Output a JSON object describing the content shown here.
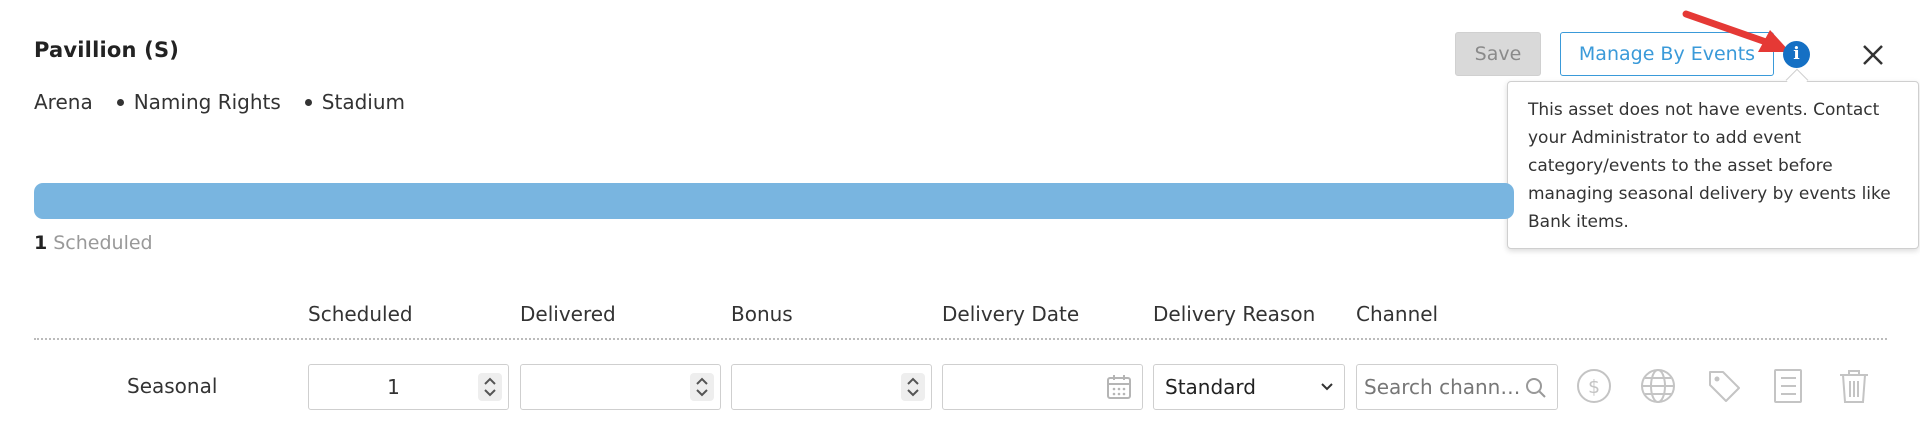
{
  "header": {
    "title": "Pavillion  (S)",
    "tags": [
      "Arena",
      "Naming Rights",
      "Stadium"
    ],
    "save_label": "Save",
    "manage_label": "Manage By Events",
    "info_glyph": "i"
  },
  "tooltip": {
    "text": "This asset does not have events. Contact your Administrator to add event category/events to the asset before managing seasonal delivery by events like Bank items."
  },
  "progress": {
    "scheduled_count": "1",
    "scheduled_label": "Scheduled"
  },
  "table": {
    "columns": [
      "Scheduled",
      "Delivered",
      "Bonus",
      "Delivery Date",
      "Delivery Reason",
      "Channel"
    ],
    "rows": [
      {
        "label": "Seasonal",
        "scheduled": "1",
        "delivered": "",
        "bonus": "",
        "delivery_date": "",
        "delivery_reason": "Standard",
        "channel_placeholder": "Search channels..."
      }
    ],
    "row_actions": [
      "dollar-icon",
      "globe-icon",
      "tag-icon",
      "list-icon",
      "trash-icon"
    ]
  },
  "colors": {
    "accent": "#3a9ad9",
    "info": "#1570c4",
    "progress": "#79b5e0",
    "annotation_arrow": "#e53935"
  }
}
